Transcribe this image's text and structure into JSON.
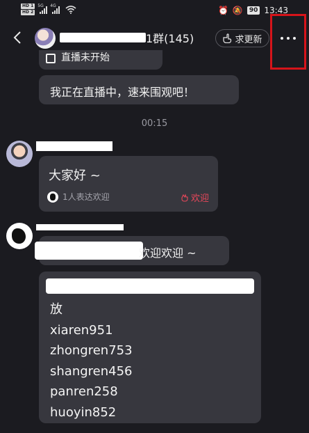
{
  "status_bar": {
    "hd1": "HD 1",
    "hd2": "HD 2",
    "sig1_label": "5G",
    "sig2_label": "4G",
    "battery": "90",
    "time": "13:43"
  },
  "nav": {
    "title_suffix": "1群(145)",
    "request_update": "求更新"
  },
  "messages": {
    "live_partial": "直播未开始",
    "live_msg": "我正在直播中，速来围观吧！",
    "time": "00:15",
    "hello": "大家好 ~",
    "reaction_count": "1人表达欢迎",
    "welcome_btn": "欢迎",
    "welcome2": "欢迎欢迎 ~",
    "list_lines": [
      "放",
      "xiaren951",
      "zhongren753",
      "shangren456",
      "panren258",
      "huoyin852"
    ]
  },
  "colors": {
    "background": "#1b1b20",
    "bubble": "#37373e",
    "accent_red": "#e8475a",
    "highlight": "#d6141a"
  }
}
